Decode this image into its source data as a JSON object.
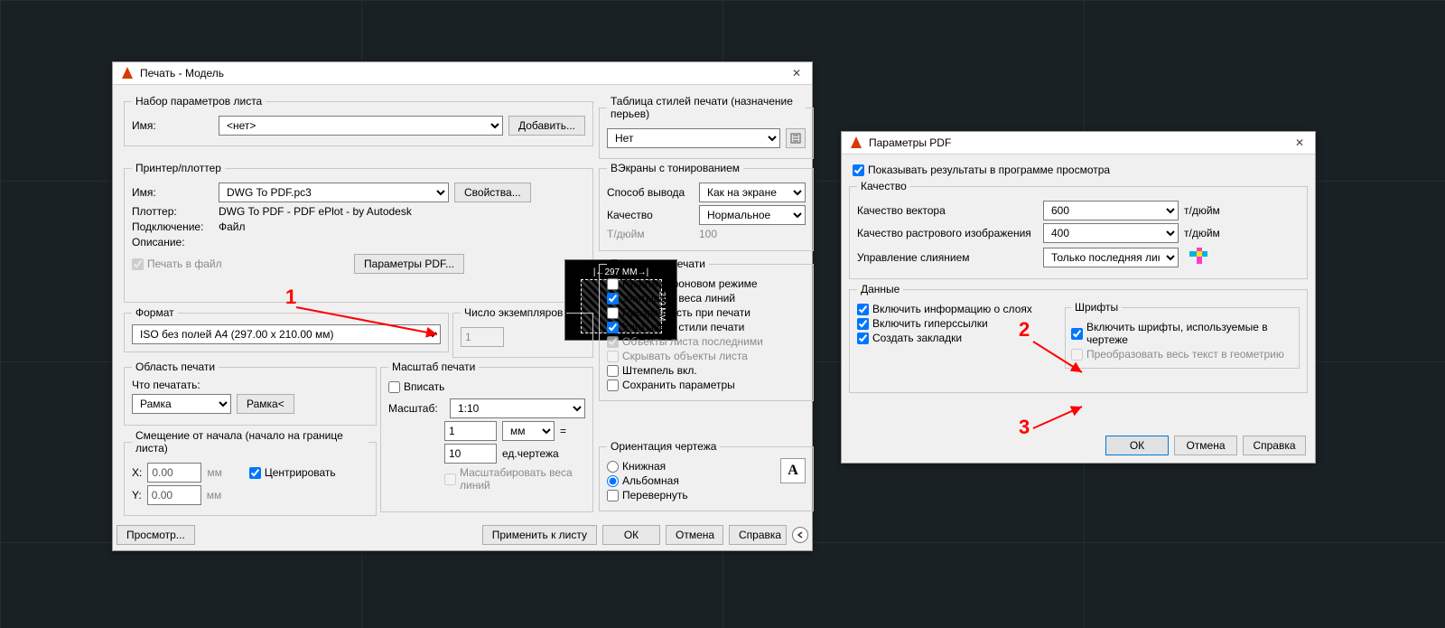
{
  "plot": {
    "title": "Печать - Модель",
    "pageset": {
      "legend": "Набор параметров листа",
      "name_label": "Имя:",
      "name_value": "<нет>",
      "add_btn": "Добавить..."
    },
    "printer": {
      "legend": "Принтер/плоттер",
      "name_label": "Имя:",
      "name_value": "DWG To PDF.pc3",
      "props_btn": "Свойства...",
      "plotter_label": "Плоттер:",
      "plotter_value": "DWG To PDF - PDF ePlot - by Autodesk",
      "port_label": "Подключение:",
      "port_value": "Файл",
      "desc_label": "Описание:",
      "plot_to_file": "Печать в файл",
      "pdf_opts_btn": "Параметры PDF...",
      "preview_w": "297 MM",
      "preview_h": "210 MM"
    },
    "paper": {
      "legend": "Формат",
      "value": "ISO без полей A4 (297.00 x 210.00 мм)"
    },
    "copies": {
      "legend": "Число экземпляров",
      "value": "1"
    },
    "area": {
      "legend": "Область печати",
      "what_label": "Что печатать:",
      "what_value": "Рамка",
      "window_btn": "Рамка<"
    },
    "offset": {
      "legend": "Смещение от начала (начало на границе листа)",
      "x_label": "X:",
      "x_value": "0.00",
      "y_label": "Y:",
      "y_value": "0.00",
      "unit": "мм",
      "center": "Центрировать"
    },
    "scale": {
      "legend": "Масштаб печати",
      "fit": "Вписать",
      "scale_label": "Масштаб:",
      "scale_value": "1:10",
      "num": "1",
      "unit_sel": "мм",
      "den": "10",
      "den_label": "ед.чертежа",
      "scale_lw": "Масштабировать веса линий"
    },
    "styletab": {
      "legend": "Таблица стилей печати (назначение перьев)",
      "value": "Нет"
    },
    "shaded": {
      "legend": "ВЭкраны с тонированием",
      "shade_label": "Способ вывода",
      "shade_value": "Как на экране",
      "quality_label": "Качество",
      "quality_value": "Нормальное",
      "dpi_label": "Т/дюйм",
      "dpi_value": "100"
    },
    "options": {
      "legend": "Параметры печати",
      "bg": "Печать в фоновом режиме",
      "lw": "Учитывать веса линий",
      "transp": "Прозрачность при печати",
      "styles": "Учитывать стили печати",
      "ps_last": "Объекты листа последними",
      "hide": "Скрывать объекты листа",
      "stamp": "Штемпель вкл.",
      "save": "Сохранить параметры"
    },
    "orient": {
      "legend": "Ориентация чертежа",
      "portrait": "Книжная",
      "landscape": "Альбомная",
      "upside": "Перевернуть"
    },
    "footer": {
      "preview": "Просмотр...",
      "apply": "Применить к листу",
      "ok": "ОК",
      "cancel": "Отмена",
      "help": "Справка"
    }
  },
  "pdf": {
    "title": "Параметры PDF",
    "show_results": "Показывать результаты в программе просмотра",
    "quality": {
      "legend": "Качество",
      "vector_label": "Качество вектора",
      "vector_value": "600",
      "raster_label": "Качество растрового изображения",
      "raster_value": "400",
      "unit": "т/дюйм",
      "merge_label": "Управление слиянием",
      "merge_value": "Только последняя линия"
    },
    "data": {
      "legend": "Данные",
      "layers": "Включить информацию о слоях",
      "hyperlinks": "Включить гиперссылки",
      "bookmarks": "Создать закладки",
      "fonts_legend": "Шрифты",
      "fonts_incl": "Включить шрифты, используемые в чертеже",
      "text_geom": "Преобразовать весь текст в геометрию"
    },
    "buttons": {
      "ok": "ОК",
      "cancel": "Отмена",
      "help": "Справка"
    }
  },
  "annotations": {
    "n1": "1",
    "n2": "2",
    "n3": "3"
  }
}
